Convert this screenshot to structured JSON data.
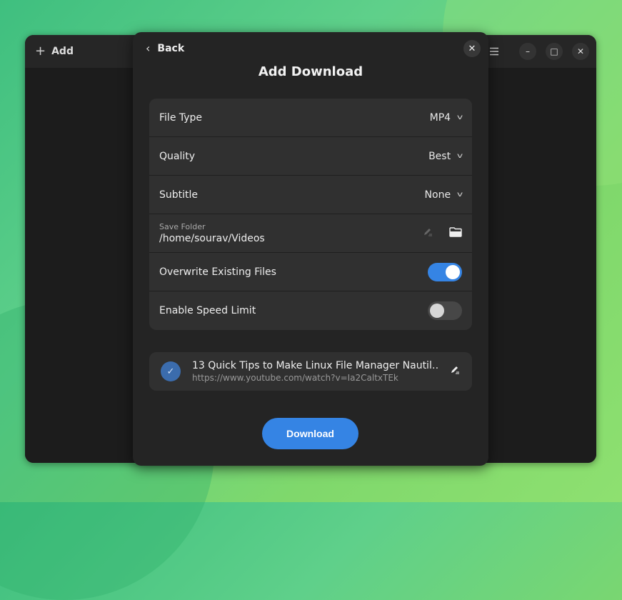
{
  "main_window": {
    "add_label": "Add",
    "add_icon": "plus-icon",
    "controls": {
      "menu_icon": "hamburger-menu-icon",
      "minimize": "–",
      "maximize": "□",
      "close": "✕"
    }
  },
  "dialog": {
    "back_label": "Back",
    "back_icon": "‹",
    "close_icon": "✕",
    "title": "Add Download",
    "settings": {
      "file_type": {
        "label": "File Type",
        "value": "MP4"
      },
      "quality": {
        "label": "Quality",
        "value": "Best"
      },
      "subtitle": {
        "label": "Subtitle",
        "value": "None"
      },
      "save_folder": {
        "label": "Save Folder",
        "value": "/home/sourav/Videos"
      },
      "overwrite": {
        "label": "Overwrite Existing Files",
        "enabled": true
      },
      "speed_limit": {
        "label": "Enable Speed Limit",
        "enabled": false
      }
    },
    "video": {
      "title": "13 Quick Tips to Make Linux File Manager Nautil…",
      "url": "https://www.youtube.com/watch?v=Ia2CaltxTEk",
      "selected": true
    },
    "download_label": "Download"
  },
  "colors": {
    "accent": "#3584e4",
    "dialog_bg": "#242424",
    "row_bg": "#303030"
  }
}
